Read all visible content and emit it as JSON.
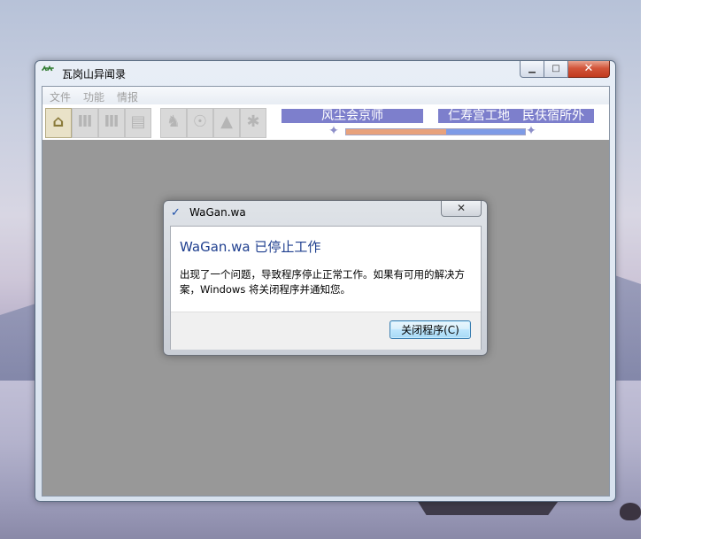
{
  "app": {
    "title": "瓦岗山异闻录",
    "icon": "bamboo-app-icon",
    "menu": [
      "文件",
      "功能",
      "情报"
    ],
    "toolbar_icons": [
      "palace-icon",
      "city-gate-icon",
      "city-gate-icon",
      "scroll-icon",
      "cavalry-icon",
      "bag-icon",
      "mountain-icon",
      "army-icon"
    ],
    "status": {
      "left_label": "风尘会京师",
      "right_label": "仁寿宫工地　民伕宿所外",
      "progress_left": 0.56,
      "progress_right": 0.44
    }
  },
  "dialog": {
    "title": "WaGan.wa",
    "heading": "WaGan.wa 已停止工作",
    "message": "出现了一个问题，导致程序停止正常工作。如果有可用的解决方案，Windows 将关闭程序并通知您。",
    "button_label": "关闭程序(C)"
  },
  "colors": {
    "client_bg": "#989898",
    "status_label": "#7d7fcc",
    "heading": "#1f3f8f"
  }
}
